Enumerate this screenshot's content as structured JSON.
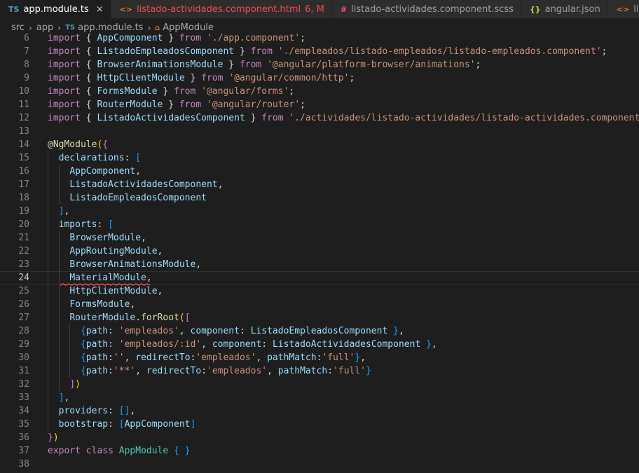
{
  "tabs": [
    {
      "icon": "TS",
      "label": "app.module.ts",
      "active": true,
      "close": "×"
    },
    {
      "icon": "<>",
      "label": "listado-actividades.component.html",
      "modified": "6, M"
    },
    {
      "icon": "#",
      "label": "listado-actividades.component.scss"
    },
    {
      "icon": "{}",
      "label": "angular.json"
    },
    {
      "icon": "<>",
      "label": "listado-e"
    }
  ],
  "breadcrumb": {
    "segments": [
      "src",
      "app"
    ],
    "file_icon": "TS",
    "file": "app.module.ts",
    "symbol_icon": "⌂",
    "symbol": "AppModule"
  },
  "editor": {
    "current_line": 24,
    "lines": [
      {
        "n": 6,
        "tokens": [
          [
            "import ",
            "k"
          ],
          [
            "{ ",
            "p"
          ],
          [
            "AppComponent",
            "v"
          ],
          [
            " } ",
            "p"
          ],
          [
            "from ",
            "k"
          ],
          [
            "'./app.component'",
            "s"
          ],
          [
            ";",
            "p"
          ]
        ]
      },
      {
        "n": 7,
        "tokens": [
          [
            "import ",
            "k"
          ],
          [
            "{ ",
            "p"
          ],
          [
            "ListadoEmpleadosComponent",
            "v"
          ],
          [
            " } ",
            "p"
          ],
          [
            "from ",
            "k"
          ],
          [
            "'./empleados/listado-empleados/listado-empleados.component'",
            "s"
          ],
          [
            ";",
            "p"
          ]
        ]
      },
      {
        "n": 8,
        "tokens": [
          [
            "import ",
            "k"
          ],
          [
            "{ ",
            "p"
          ],
          [
            "BrowserAnimationsModule",
            "v"
          ],
          [
            " } ",
            "p"
          ],
          [
            "from ",
            "k"
          ],
          [
            "'@angular/platform-browser/animations'",
            "s"
          ],
          [
            ";",
            "p"
          ]
        ]
      },
      {
        "n": 9,
        "tokens": [
          [
            "import ",
            "k"
          ],
          [
            "{ ",
            "p"
          ],
          [
            "HttpClientModule",
            "v"
          ],
          [
            " } ",
            "p"
          ],
          [
            "from ",
            "k"
          ],
          [
            "'@angular/common/http'",
            "s"
          ],
          [
            ";",
            "p"
          ]
        ]
      },
      {
        "n": 10,
        "tokens": [
          [
            "import ",
            "k"
          ],
          [
            "{ ",
            "p"
          ],
          [
            "FormsModule",
            "v"
          ],
          [
            " } ",
            "p"
          ],
          [
            "from ",
            "k"
          ],
          [
            "'@angular/forms'",
            "s"
          ],
          [
            ";",
            "p"
          ]
        ]
      },
      {
        "n": 11,
        "tokens": [
          [
            "import ",
            "k"
          ],
          [
            "{ ",
            "p"
          ],
          [
            "RouterModule",
            "v"
          ],
          [
            " } ",
            "p"
          ],
          [
            "from ",
            "k"
          ],
          [
            "'@angular/router'",
            "s"
          ],
          [
            ";",
            "p"
          ]
        ]
      },
      {
        "n": 12,
        "tokens": [
          [
            "import ",
            "k"
          ],
          [
            "{ ",
            "p"
          ],
          [
            "ListadoActividadesComponent",
            "v"
          ],
          [
            " } ",
            "p"
          ],
          [
            "from ",
            "k"
          ],
          [
            "'./actividades/listado-actividades/listado-actividades.component'",
            "s"
          ],
          [
            ";",
            "p"
          ]
        ]
      },
      {
        "n": 13,
        "tokens": []
      },
      {
        "n": 14,
        "tokens": [
          [
            "@",
            "p"
          ],
          [
            "NgModule",
            "f"
          ],
          [
            "(",
            "y"
          ],
          [
            "{",
            "m"
          ]
        ]
      },
      {
        "n": 15,
        "tokens": [
          [
            "  ",
            "p"
          ],
          [
            "declarations",
            "v"
          ],
          [
            ": ",
            "p"
          ],
          [
            "[",
            "b"
          ]
        ]
      },
      {
        "n": 16,
        "tokens": [
          [
            "    ",
            "p"
          ],
          [
            "AppComponent",
            "v"
          ],
          [
            ",",
            "p"
          ]
        ]
      },
      {
        "n": 17,
        "tokens": [
          [
            "    ",
            "p"
          ],
          [
            "ListadoActividadesComponent",
            "v"
          ],
          [
            ",",
            "p"
          ]
        ]
      },
      {
        "n": 18,
        "tokens": [
          [
            "    ",
            "p"
          ],
          [
            "ListadoEmpleadosComponent",
            "v"
          ]
        ]
      },
      {
        "n": 19,
        "tokens": [
          [
            "  ",
            "p"
          ],
          [
            "]",
            "b"
          ],
          [
            ",",
            "p"
          ]
        ]
      },
      {
        "n": 20,
        "tokens": [
          [
            "  ",
            "p"
          ],
          [
            "imports",
            "v"
          ],
          [
            ": ",
            "p"
          ],
          [
            "[",
            "b"
          ]
        ]
      },
      {
        "n": 21,
        "tokens": [
          [
            "    ",
            "p"
          ],
          [
            "BrowserModule",
            "v"
          ],
          [
            ",",
            "p"
          ]
        ]
      },
      {
        "n": 22,
        "tokens": [
          [
            "    ",
            "p"
          ],
          [
            "AppRoutingModule",
            "v"
          ],
          [
            ",",
            "p"
          ]
        ]
      },
      {
        "n": 23,
        "tokens": [
          [
            "    ",
            "p"
          ],
          [
            "BrowserAnimationsModule",
            "v"
          ],
          [
            ",",
            "p"
          ]
        ]
      },
      {
        "n": 24,
        "tokens": [
          [
            "    ",
            "p"
          ],
          [
            "MaterialModule",
            "v"
          ],
          [
            ",",
            "p"
          ]
        ]
      },
      {
        "n": 25,
        "tokens": [
          [
            "    ",
            "p"
          ],
          [
            "HttpClientModule",
            "v"
          ],
          [
            ",",
            "p"
          ]
        ]
      },
      {
        "n": 26,
        "tokens": [
          [
            "    ",
            "p"
          ],
          [
            "FormsModule",
            "v"
          ],
          [
            ",",
            "p"
          ]
        ]
      },
      {
        "n": 27,
        "tokens": [
          [
            "    ",
            "p"
          ],
          [
            "RouterModule",
            "v"
          ],
          [
            ".",
            "p"
          ],
          [
            "forRoot",
            "f"
          ],
          [
            "(",
            "y"
          ],
          [
            "[",
            "m"
          ]
        ]
      },
      {
        "n": 28,
        "tokens": [
          [
            "      ",
            "p"
          ],
          [
            "{",
            "b"
          ],
          [
            "path",
            "v"
          ],
          [
            ": ",
            "p"
          ],
          [
            "'empleados'",
            "s"
          ],
          [
            ", ",
            "p"
          ],
          [
            "component",
            "v"
          ],
          [
            ": ",
            "p"
          ],
          [
            "ListadoEmpleadosComponent",
            "v"
          ],
          [
            " ",
            "p"
          ],
          [
            "}",
            "b"
          ],
          [
            ",",
            "p"
          ]
        ]
      },
      {
        "n": 29,
        "tokens": [
          [
            "      ",
            "p"
          ],
          [
            "{",
            "b"
          ],
          [
            "path",
            "v"
          ],
          [
            ": ",
            "p"
          ],
          [
            "'empleados/:id'",
            "s"
          ],
          [
            ", ",
            "p"
          ],
          [
            "component",
            "v"
          ],
          [
            ": ",
            "p"
          ],
          [
            "ListadoActividadesComponent",
            "v"
          ],
          [
            " ",
            "p"
          ],
          [
            "}",
            "b"
          ],
          [
            ",",
            "p"
          ]
        ]
      },
      {
        "n": 30,
        "tokens": [
          [
            "      ",
            "p"
          ],
          [
            "{",
            "b"
          ],
          [
            "path",
            "v"
          ],
          [
            ":",
            "p"
          ],
          [
            "''",
            "s"
          ],
          [
            ", ",
            "p"
          ],
          [
            "redirectTo",
            "v"
          ],
          [
            ":",
            "p"
          ],
          [
            "'empleados'",
            "s"
          ],
          [
            ", ",
            "p"
          ],
          [
            "pathMatch",
            "v"
          ],
          [
            ":",
            "p"
          ],
          [
            "'full'",
            "s"
          ],
          [
            "}",
            "b"
          ],
          [
            ",",
            "p"
          ]
        ]
      },
      {
        "n": 31,
        "tokens": [
          [
            "      ",
            "p"
          ],
          [
            "{",
            "b"
          ],
          [
            "path",
            "v"
          ],
          [
            ":",
            "p"
          ],
          [
            "'**'",
            "s"
          ],
          [
            ", ",
            "p"
          ],
          [
            "redirectTo",
            "v"
          ],
          [
            ":",
            "p"
          ],
          [
            "'empleados'",
            "s"
          ],
          [
            ", ",
            "p"
          ],
          [
            "pathMatch",
            "v"
          ],
          [
            ":",
            "p"
          ],
          [
            "'full'",
            "s"
          ],
          [
            "}",
            "b"
          ]
        ]
      },
      {
        "n": 32,
        "tokens": [
          [
            "    ",
            "p"
          ],
          [
            "]",
            "m"
          ],
          [
            ")",
            "y"
          ]
        ]
      },
      {
        "n": 33,
        "tokens": [
          [
            "  ",
            "p"
          ],
          [
            "]",
            "b"
          ],
          [
            ",",
            "p"
          ]
        ]
      },
      {
        "n": 34,
        "tokens": [
          [
            "  ",
            "p"
          ],
          [
            "providers",
            "v"
          ],
          [
            ": ",
            "p"
          ],
          [
            "[]",
            "b"
          ],
          [
            ",",
            "p"
          ]
        ]
      },
      {
        "n": 35,
        "tokens": [
          [
            "  ",
            "p"
          ],
          [
            "bootstrap",
            "v"
          ],
          [
            ": ",
            "p"
          ],
          [
            "[",
            "b"
          ],
          [
            "AppComponent",
            "v"
          ],
          [
            "]",
            "b"
          ]
        ]
      },
      {
        "n": 36,
        "tokens": [
          [
            "}",
            "m"
          ],
          [
            ")",
            "y"
          ]
        ]
      },
      {
        "n": 37,
        "tokens": [
          [
            "export ",
            "k"
          ],
          [
            "class ",
            "k"
          ],
          [
            "AppModule",
            "c"
          ],
          [
            " ",
            "p"
          ],
          [
            "{",
            "b"
          ],
          [
            " ",
            "p"
          ],
          [
            "}",
            "b"
          ]
        ]
      },
      {
        "n": 38,
        "tokens": []
      }
    ]
  },
  "colors": {
    "k": "#c586c0",
    "v": "#9cdcfe",
    "s": "#ce9178",
    "p": "#d4d4d4",
    "f": "#dcdcaa",
    "y": "#ffd700",
    "m": "#da70d6",
    "b": "#179fff",
    "c": "#4ec9b0",
    "error": "#f14c4c",
    "ts_icon": "#519aba",
    "html_icon": "#e37933",
    "scss_icon": "#f55385",
    "json_icon": "#cbcb41"
  }
}
